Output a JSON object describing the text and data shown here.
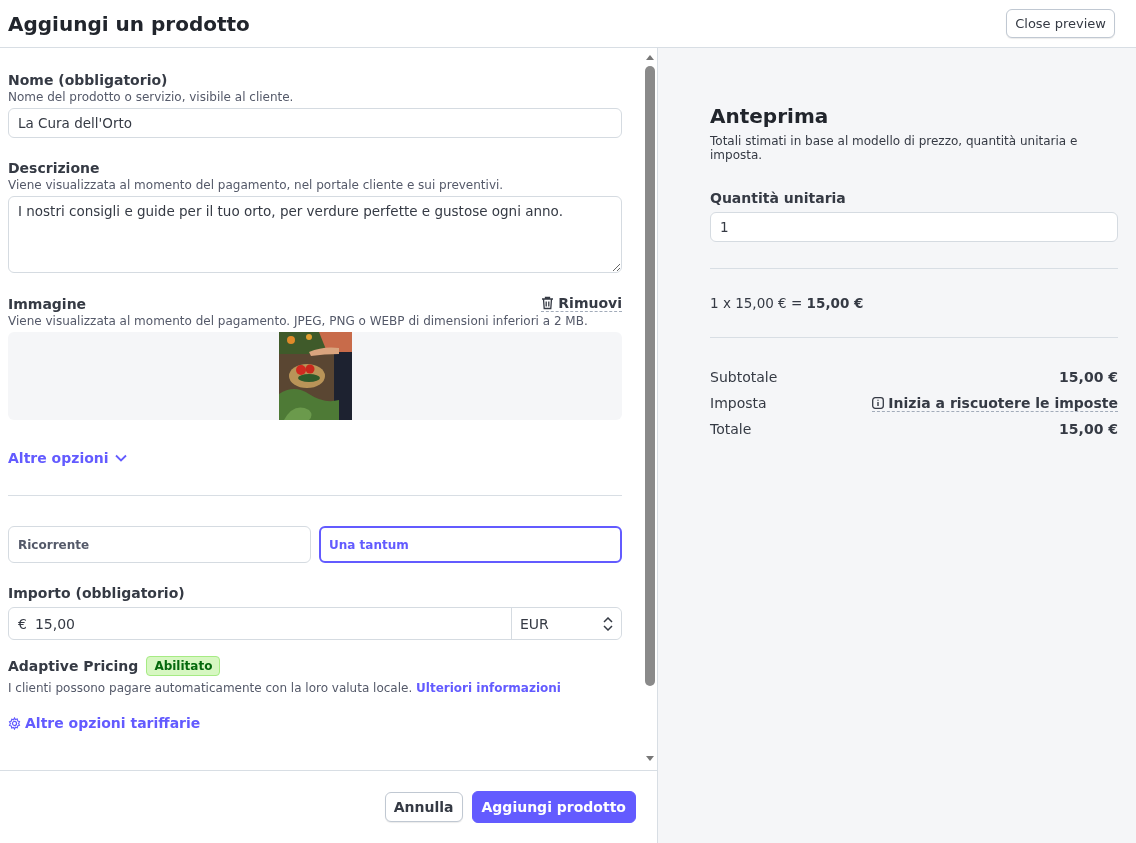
{
  "header": {
    "title": "Aggiungi un prodotto",
    "close_button": "Close preview"
  },
  "form": {
    "name": {
      "label": "Nome (obbligatorio)",
      "hint": "Nome del prodotto o servizio, visibile al cliente.",
      "value": "La Cura dell'Orto"
    },
    "description": {
      "label": "Descrizione",
      "hint": "Viene visualizzata al momento del pagamento, nel portale cliente e sui preventivi.",
      "value": "I nostri consigli e guide per il tuo orto, per verdure perfette e gustose ogni anno."
    },
    "image": {
      "label": "Immagine",
      "remove": "Rimuovi",
      "hint": "Viene visualizzata al momento del pagamento. JPEG, PNG o WEBP di dimensioni inferiori a 2 MB.",
      "kind": "picture"
    },
    "more_options": "Altre opzioni",
    "pricing_types": [
      {
        "label": "Ricorrente",
        "selected": false
      },
      {
        "label": "Una tantum",
        "selected": true
      }
    ],
    "amount": {
      "label": "Importo (obbligatorio)",
      "currency_symbol": "€",
      "value": "15,00",
      "currency": "EUR"
    },
    "adaptive": {
      "label": "Adaptive Pricing",
      "badge": "Abilitato",
      "text": "I clienti possono pagare automaticamente con la loro valuta locale.",
      "link": "Ulteriori informazioni"
    },
    "more_pricing": "Altre opzioni tariffarie"
  },
  "footer": {
    "cancel": "Annulla",
    "submit": "Aggiungi prodotto"
  },
  "preview": {
    "title": "Anteprima",
    "subtitle": "Totali stimati in base al modello di prezzo, quantità unitaria e imposta.",
    "quantity": {
      "label": "Quantità unitaria",
      "value": "1"
    },
    "formula": "1 x 15,00 € = **15,00 €**",
    "summary": [
      {
        "kind": "amount",
        "label": "Subtotale",
        "value": "15,00 €"
      },
      {
        "kind": "link",
        "label": "Imposta",
        "value": "Inizia a riscuotere le imposte"
      },
      {
        "kind": "amount",
        "label": "Totale",
        "value": "15,00 €"
      }
    ]
  }
}
